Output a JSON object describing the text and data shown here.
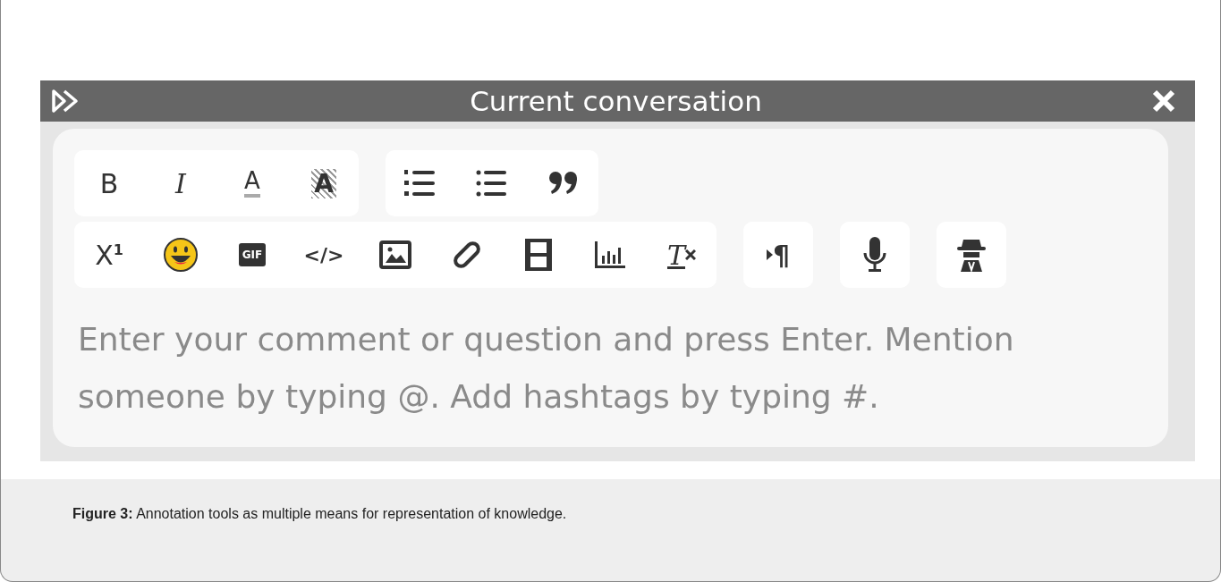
{
  "panel": {
    "title": "Current conversation"
  },
  "toolbar_rows": [
    [
      [
        {
          "kind": "bold",
          "glyph": "B"
        },
        {
          "kind": "italic",
          "glyph": "I"
        },
        {
          "kind": "font-color",
          "glyph": "A"
        },
        {
          "kind": "highlight",
          "glyph": "A"
        }
      ],
      [
        {
          "kind": "ordered-list"
        },
        {
          "kind": "bullet-list"
        },
        {
          "kind": "quote"
        }
      ]
    ],
    [
      [
        {
          "kind": "superscript",
          "glyph": "X",
          "sup": "1"
        },
        {
          "kind": "emoji"
        },
        {
          "kind": "gif",
          "glyph": "GIF"
        },
        {
          "kind": "code",
          "glyph": "</>"
        },
        {
          "kind": "image"
        },
        {
          "kind": "link"
        },
        {
          "kind": "video"
        },
        {
          "kind": "chart"
        },
        {
          "kind": "clear-format",
          "glyph": "T"
        }
      ],
      [
        {
          "kind": "paragraph",
          "glyph": "¶"
        }
      ],
      [
        {
          "kind": "microphone"
        }
      ],
      [
        {
          "kind": "incognito"
        }
      ]
    ]
  ],
  "comment_field": {
    "placeholder": "Enter your comment or question and press Enter. Mention someone by typing @. Add hashtags by typing #."
  },
  "caption": "**Figure 3:** Annotation tools as multiple means for representation of knowledge."
}
